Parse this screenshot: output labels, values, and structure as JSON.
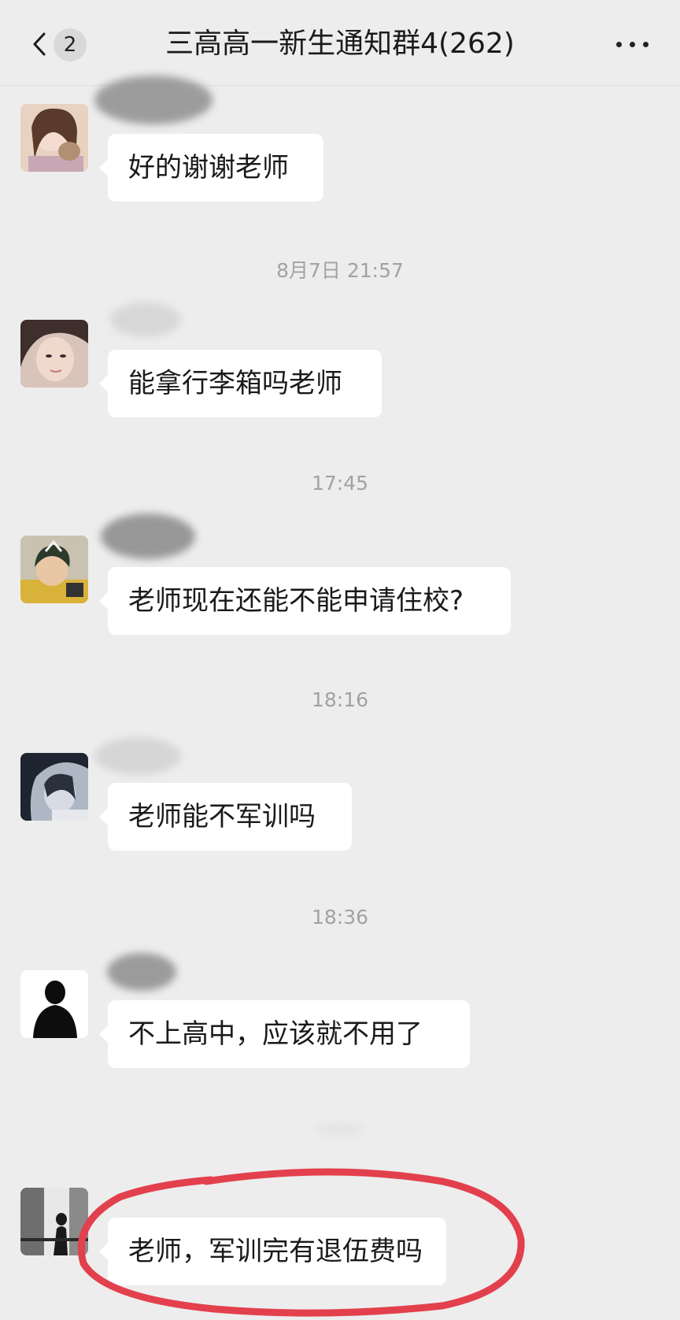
{
  "header": {
    "back_icon": "chevron-left-icon",
    "unread_count": "2",
    "title": "三高高一新生通知群4(262)",
    "more_icon": "more-dots-icon"
  },
  "chat": {
    "messages": [
      {
        "text": "好的谢谢老师"
      },
      {
        "timestamp": "8月7日 21:57",
        "text": "能拿行李箱吗老师"
      },
      {
        "timestamp": "17:45",
        "text": "老师现在还能不能申请住校?"
      },
      {
        "timestamp": "18:16",
        "text": "老师能不军训吗"
      },
      {
        "timestamp": "18:36",
        "text": "不上高中，应该就不用了"
      },
      {
        "text": "老师，军训完有退伍费吗"
      }
    ]
  },
  "colors": {
    "background": "#ededed",
    "bubble": "#ffffff",
    "timestamp_text": "#a2a2a2",
    "highlight": "#e3404d"
  }
}
